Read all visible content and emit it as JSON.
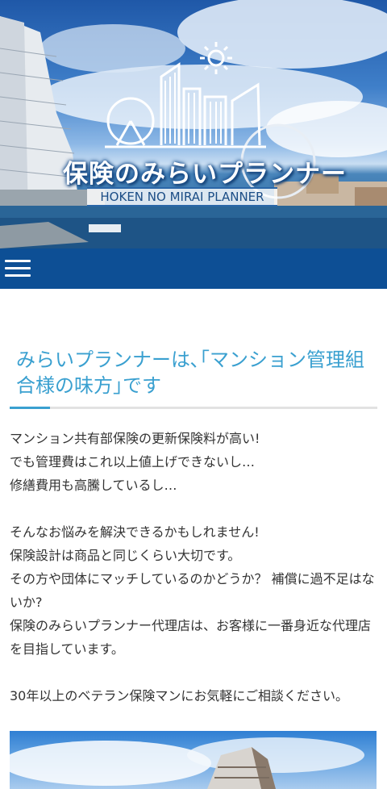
{
  "header": {
    "logo_title": "保険のみらいプランナー",
    "logo_subtitle": "HOKEN NO MIRAI PLANNER"
  },
  "nav": {
    "menu_icon": "hamburger-menu-icon"
  },
  "main": {
    "heading": "みらいプランナーは､｢マンション管理組合様の味方｣です",
    "paragraphs": [
      "マンション共有部保険の更新保険料が高い!",
      "でも管理費はこれ以上値上げできないし…",
      "修繕費用も高騰しているし…",
      "",
      "そんなお悩みを解決できるかもしれません!",
      "保険設計は商品と同じくらい大切です。",
      "その方や団体にマッチしているのかどうか？ 補償に過不足はないか?",
      "保険のみらいプランナー代理店は、お客様に一番身近な代理店を目指しています。",
      "",
      "30年以上のベテラン保険マンにお気軽にご相談ください。"
    ]
  },
  "colors": {
    "nav_bg": "#0d4f95",
    "heading": "#3aa0d0",
    "text": "#333333"
  }
}
